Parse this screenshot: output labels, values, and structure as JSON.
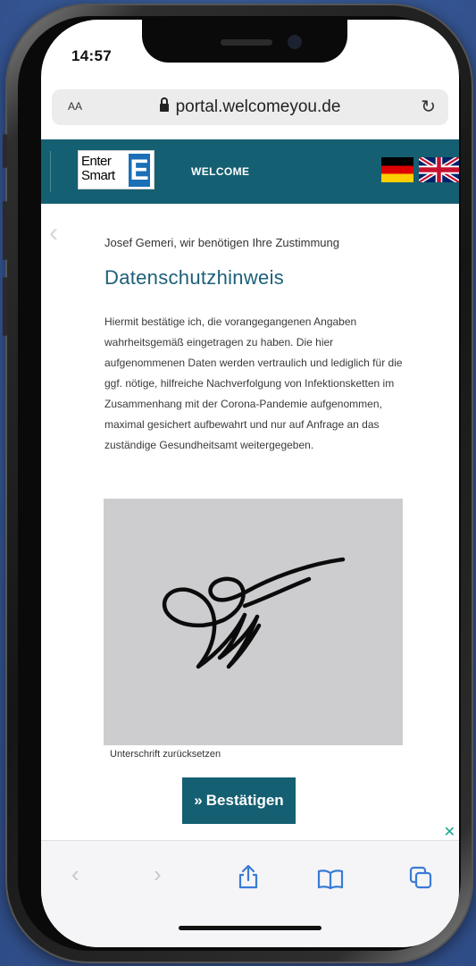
{
  "status_bar": {
    "time": "14:57"
  },
  "browser": {
    "text_size_label": "AA",
    "url": "portal.welcomeyou.de",
    "lock_icon": "lock-icon",
    "reload_icon": "reload-icon"
  },
  "site_header": {
    "logo_text_line1": "Enter",
    "logo_text_line2": "Smart",
    "logo_mark": "E",
    "nav_label": "WELCOME",
    "colors": {
      "header_bg": "#155f72",
      "logo_blue": "#1a6fb6"
    },
    "flags": [
      "german-flag-icon",
      "uk-flag-icon"
    ]
  },
  "content": {
    "consent_line": "Josef Gemeri, wir benötigen Ihre Zustimmung",
    "title": "Datenschutzhinweis",
    "paragraph": "Hiermit bestätige ich, die vorangegangenen Angaben wahrheitsgemäß eingetragen zu haben. Die hier aufgenommenen Daten werden vertraulich und lediglich für die ggf. nötige, hilfreiche Nachverfolgung von Infektionsketten im Zusammenhang mit der Corona-Pandemie aufgenommen, maximal gesichert aufbewahrt und nur auf Anfrage an das zuständige Gesundheitsamt weitergegeben.",
    "reset_signature": "Unterschrift zurücksetzen",
    "confirm_icon": "»",
    "confirm_label": "Bestätigen"
  },
  "toolbar": {
    "items": [
      "back-icon",
      "forward-icon",
      "share-icon",
      "bookmarks-icon",
      "tabs-icon"
    ]
  }
}
